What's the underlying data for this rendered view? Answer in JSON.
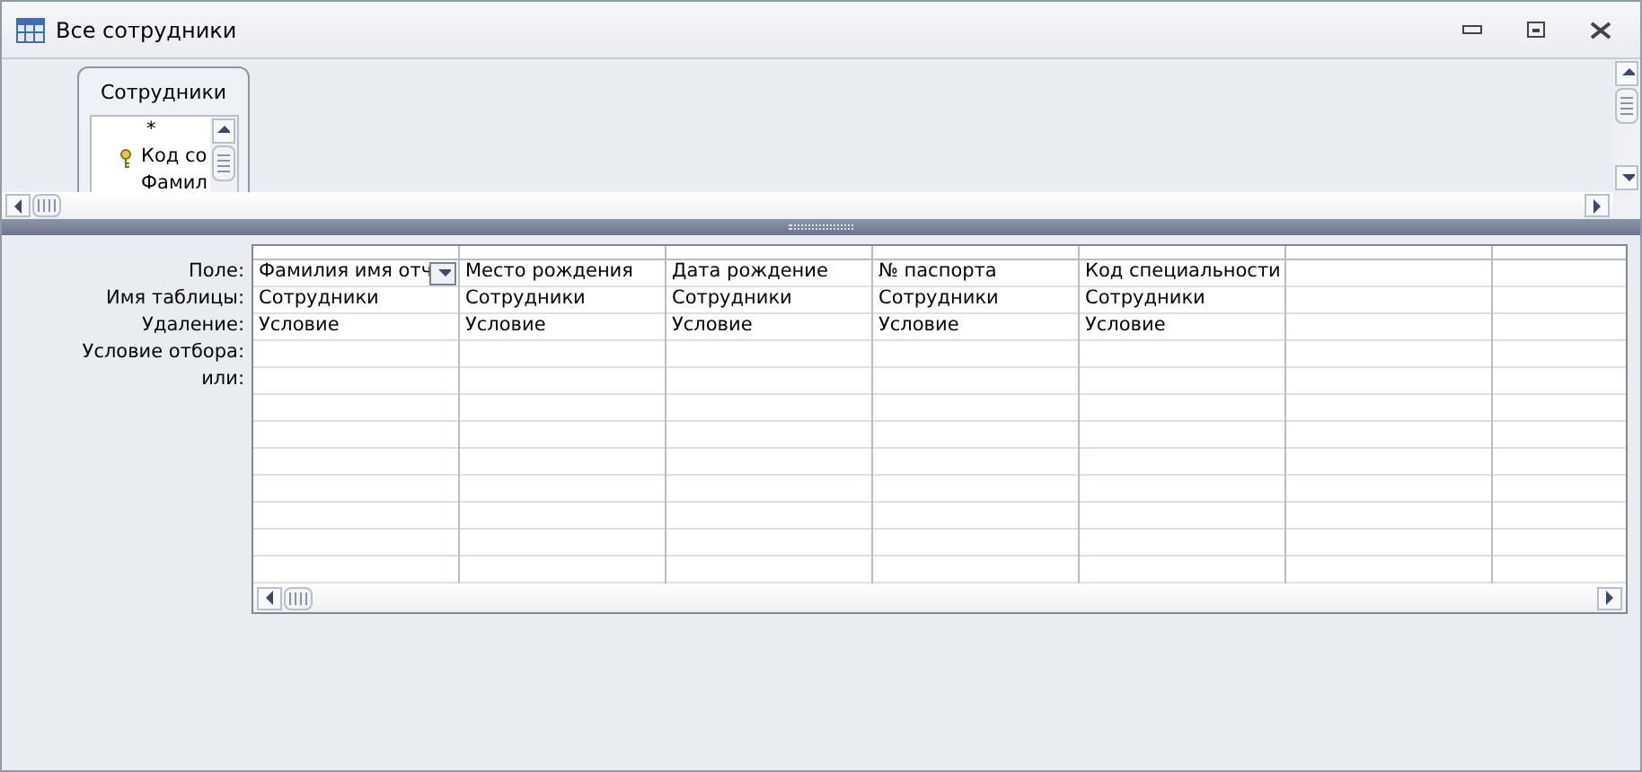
{
  "window": {
    "title": "Все сотрудники"
  },
  "field_list": {
    "title": "Сотрудники",
    "fields": [
      {
        "label": "*",
        "kind": "all"
      },
      {
        "label": "Код со",
        "kind": "key"
      },
      {
        "label": "Фамил",
        "kind": "field"
      }
    ]
  },
  "grid": {
    "row_labels": [
      "Поле:",
      "Имя таблицы:",
      "Удаление:",
      "Условие отбора:",
      "или:"
    ],
    "columns": [
      {
        "field": "Фамилия имя отч",
        "table": "Сотрудники",
        "delete": "Условие",
        "selected": true
      },
      {
        "field": "Место рождения",
        "table": "Сотрудники",
        "delete": "Условие",
        "selected": false
      },
      {
        "field": "Дата рождение",
        "table": "Сотрудники",
        "delete": "Условие",
        "selected": false
      },
      {
        "field": "№ паспорта",
        "table": "Сотрудники",
        "delete": "Условие",
        "selected": false
      },
      {
        "field": "Код специальности",
        "table": "Сотрудники",
        "delete": "Условие",
        "selected": false
      }
    ]
  }
}
